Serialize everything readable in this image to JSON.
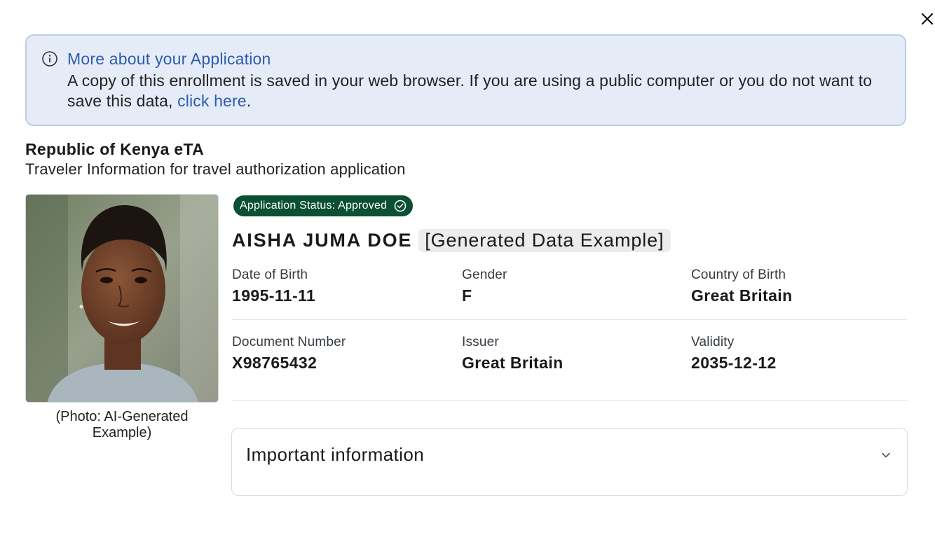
{
  "dialog": {
    "close_icon": "close-icon"
  },
  "banner": {
    "icon": "info-circle-icon",
    "title": "More about your Application",
    "text_before_link": "A copy of this enrollment is saved in your web browser. If you are using a public computer or you do not want to save this data, ",
    "link_text": "click here",
    "text_after_link": "."
  },
  "header": {
    "title": "Republic of Kenya eTA",
    "subtitle": "Traveler Information for travel authorization application"
  },
  "photo": {
    "caption": "(Photo: AI-Generated Example)"
  },
  "status": {
    "label": "Application Status: Approved",
    "icon": "check-circle-icon",
    "color": "#0b4f35"
  },
  "traveler": {
    "name": "AISHA JUMA DOE",
    "tag": "[Generated Data Example]",
    "fields": {
      "dob": {
        "label": "Date of Birth",
        "value": "1995-11-11"
      },
      "gender": {
        "label": "Gender",
        "value": "F"
      },
      "country_of_birth": {
        "label": "Country of Birth",
        "value": "Great Britain"
      },
      "document_number": {
        "label": "Document Number",
        "value": "X98765432"
      },
      "issuer": {
        "label": "Issuer",
        "value": "Great Britain"
      },
      "validity": {
        "label": "Validity",
        "value": "2035-12-12"
      }
    }
  },
  "accordion": {
    "title": "Important information",
    "icon": "chevron-down-icon"
  },
  "colors": {
    "accent": "#2e5bb1",
    "banner_bg": "#e5ecf8",
    "status_bg": "#0b4f35"
  }
}
